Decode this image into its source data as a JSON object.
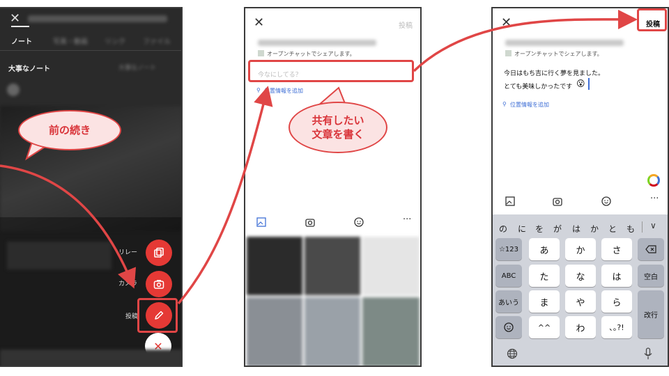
{
  "phone1": {
    "tabs": [
      "ノート",
      "写真・動画",
      "リンク",
      "ファイル"
    ],
    "section_title": "大事なノート",
    "section_more": "大事なノート",
    "fab_labels": {
      "relay": "リレー",
      "camera": "カメラ",
      "post": "投稿"
    },
    "callout": "前の続き"
  },
  "phone2": {
    "post_label": "投稿",
    "share_note": "オープンチャットでシェアします。",
    "text_placeholder": "今なにしてる？",
    "location_label": "位置情報を追加",
    "callout_line1": "共有したい",
    "callout_line2": "文章を書く"
  },
  "phone3": {
    "post_label": "投稿",
    "share_note": "オープンチャットでシェアします。",
    "text_line1": "今日はもち吉に行く夢を見ました。",
    "text_line2": "とても美味しかったです",
    "emoji": "😮",
    "location_label": "位置情報を追加",
    "candidates": [
      "の",
      "に",
      "を",
      "が",
      "は",
      "か",
      "と",
      "も"
    ],
    "keys": {
      "num": "☆123",
      "abc": "ABC",
      "aiu": "あいう",
      "a": "あ",
      "ka": "か",
      "sa": "さ",
      "ta": "た",
      "na": "な",
      "ha": "は",
      "ma": "ま",
      "ya": "や",
      "ra": "ら",
      "mark": "^^",
      "wa": "わ",
      "punct": "､｡?!",
      "space": "空白",
      "enter": "改行"
    }
  },
  "colors": {
    "accent": "#e53935",
    "callout_border": "#e04646",
    "callout_fill": "#fbe3e3",
    "link": "#3f6fd6"
  }
}
